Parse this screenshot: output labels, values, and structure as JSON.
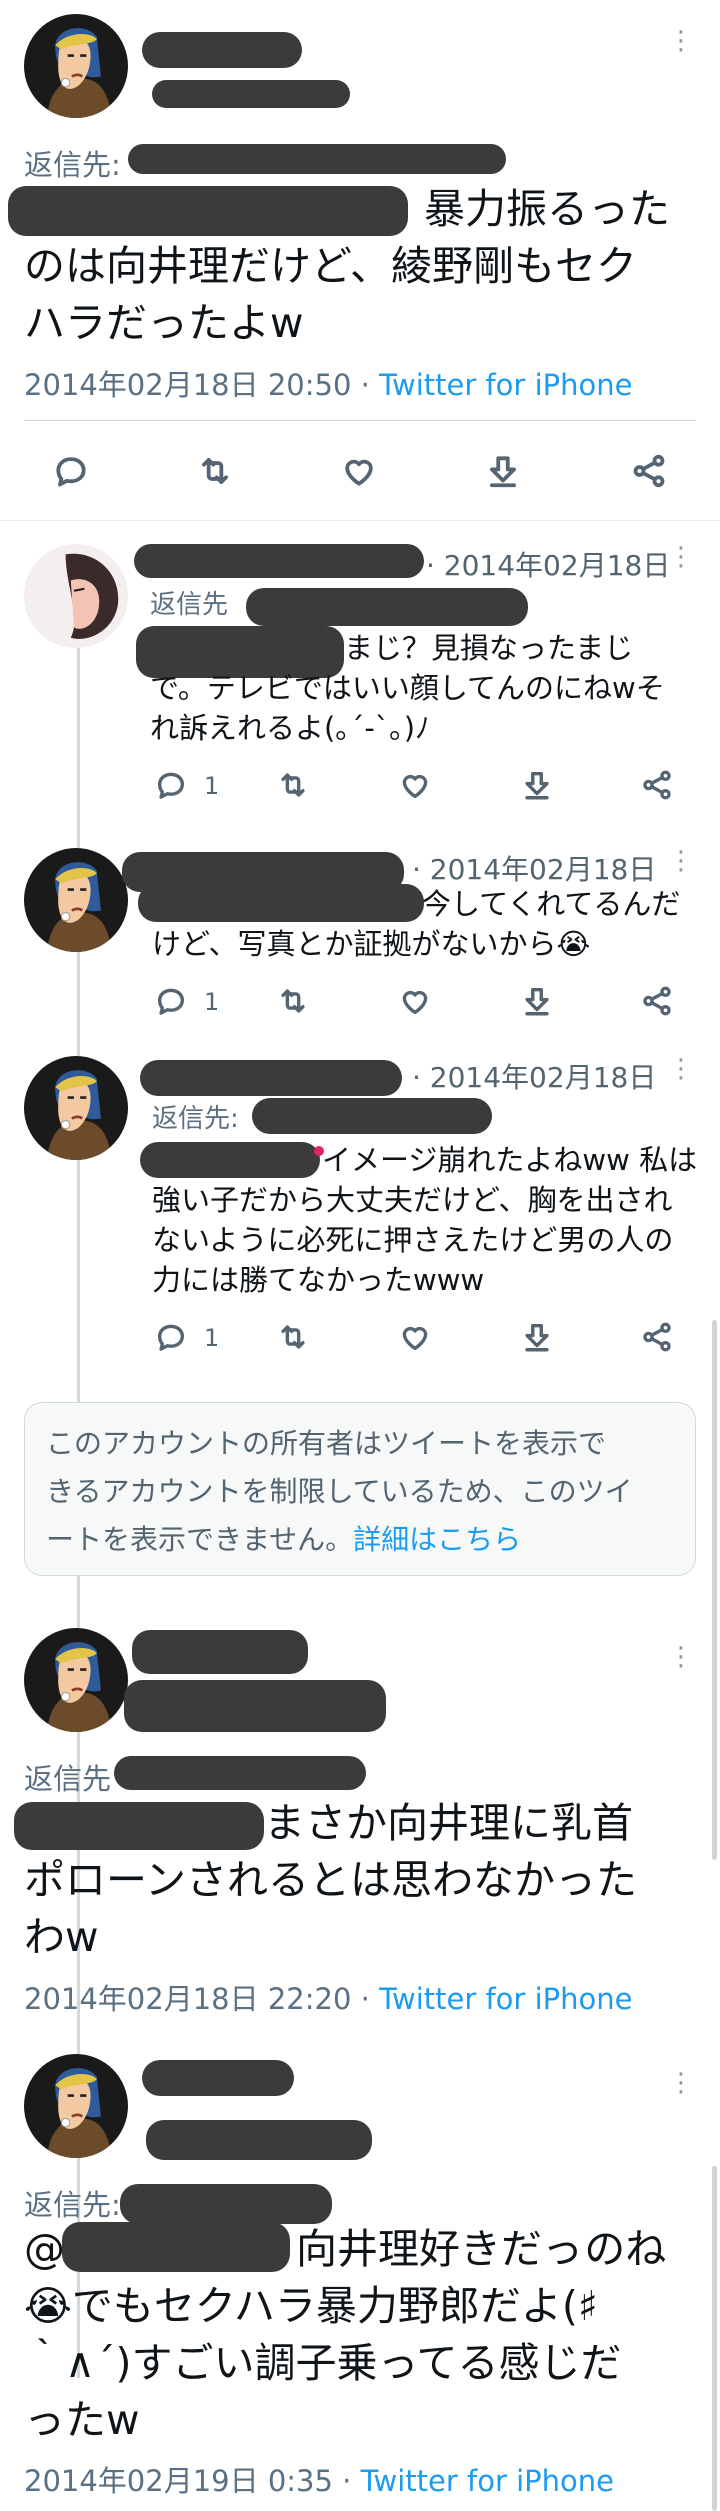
{
  "main_tweet": {
    "reply_to_label": "返信先:",
    "body_visible": "暴力振るったのは向井理だけど、綾野剛もセクハラだったよw",
    "line1": "暴力振るった",
    "line2": "のは向井理だけど、綾野剛もセク",
    "line3": "ハラだったよw",
    "date": "2014年02月18日 20:50",
    "sep": "·",
    "source": "Twitter for iPhone"
  },
  "replies": [
    {
      "date": "· 2014年02月18日",
      "reply_to_label": "返信先",
      "line1": "まじ？見損なったまじ",
      "line2": "で。テレビではいい顔してんのにねwそ",
      "line3": "れ訴えれるよ(｡ˊ-ˋ｡)ﾉ",
      "reply_count": "1"
    },
    {
      "date": "· 2014年02月18日",
      "line1": "今してくれてるんだ",
      "line2": "けど、写真とか証拠がないから😭",
      "reply_count": "1"
    },
    {
      "date": "· 2014年02月18日",
      "reply_to_label": "返信先:",
      "line1": "イメージ崩れたよねww 私は",
      "line2": "強い子だから大丈夫だけど、胸を出され",
      "line3": "ないように必死に押さえたけど男の人の",
      "line4": "力には勝てなかったwww",
      "reply_count": "1"
    }
  ],
  "restricted_notice": {
    "line1": "このアカウントの所有者はツイートを表示で",
    "line2": "きるアカウントを制限しているため、このツイ",
    "line3": "ートを表示できません。",
    "link": "詳細はこちら"
  },
  "tweet2": {
    "reply_to_label": "返信先",
    "line1": "まさか向井理に乳首",
    "line2": "ポローンされるとは思わなかった",
    "line3": "わw",
    "date": "2014年02月18日 22:20",
    "sep": "·",
    "source": "Twitter for iPhone"
  },
  "tweet3": {
    "reply_to_label": "返信先:",
    "at": "@",
    "line1": "向井理好きだっのね",
    "line2": "😭でもセクハラ暴力野郎だよ(♯",
    "line3": "｀∧´)すごい調子乗ってる感じだ",
    "line4": "ったw",
    "date": "2014年02月19日 0:35",
    "sep": "·",
    "source": "Twitter for iPhone"
  },
  "icons": [
    "more-icon",
    "reply-icon",
    "retweet-icon",
    "like-icon",
    "download-icon",
    "share-icon"
  ],
  "colors": {
    "link": "#1d9bf0",
    "text": "#0f1419",
    "muted": "#536471",
    "redaction": "#3b3b3b",
    "thread": "#cfd9de"
  }
}
